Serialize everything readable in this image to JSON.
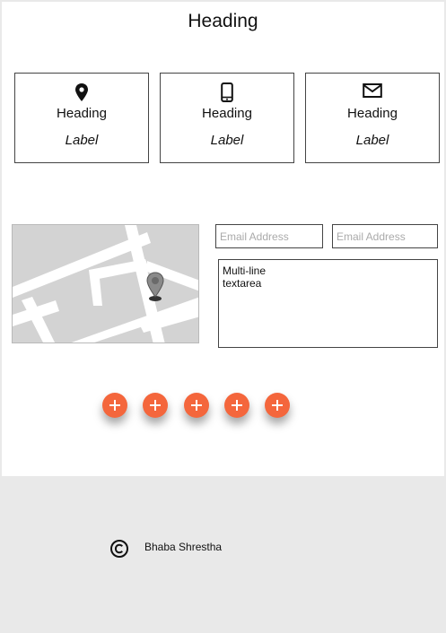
{
  "page": {
    "title": "Heading"
  },
  "cards": [
    {
      "icon": "location-pin-icon",
      "heading": "Heading",
      "label": "Label"
    },
    {
      "icon": "smartphone-icon",
      "heading": "Heading",
      "label": "Label"
    },
    {
      "icon": "envelope-icon",
      "heading": "Heading",
      "label": "Label"
    }
  ],
  "contact": {
    "email_placeholder_1": "Email Address",
    "email_placeholder_2": "Email Address",
    "textarea_value": "Multi-line\ntextarea"
  },
  "fab_buttons": [
    {
      "icon": "plus-icon"
    },
    {
      "icon": "plus-icon"
    },
    {
      "icon": "plus-icon"
    },
    {
      "icon": "plus-icon"
    },
    {
      "icon": "plus-icon"
    }
  ],
  "footer": {
    "author": "Bhaba Shrestha",
    "icon": "copyright-icon"
  },
  "colors": {
    "accent": "#f4663c",
    "footer_bg": "#e9e9e9",
    "map_bg": "#d3d3d3"
  }
}
